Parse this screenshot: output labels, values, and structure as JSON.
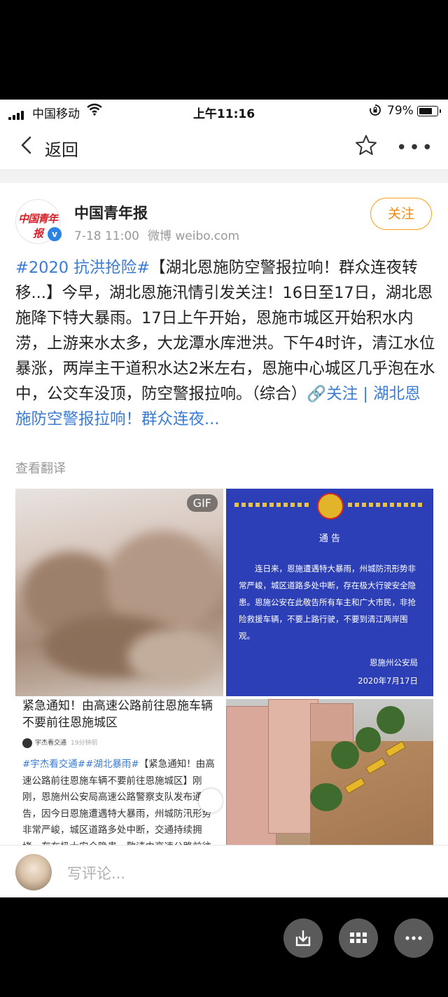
{
  "status_bar": {
    "carrier": "中国移动",
    "time": "上午11:16",
    "battery_pct": "79%",
    "battery_level": 0.79
  },
  "nav": {
    "back_label": "返回",
    "star_icon": "star-icon",
    "more_icon": "more-icon"
  },
  "post": {
    "author": "中国青年报",
    "avatar_text": "中国青年报",
    "date": "7-18 11:00",
    "source": "微博 weibo.com",
    "follow_label": "关注",
    "hashtag": "#2020 抗洪抢险#",
    "body": "【湖北恩施防空警报拉响！群众连夜转移...】今早，湖北恩施汛情引发关注！16日至17日，湖北恩施降下特大暴雨。17日上午开始，恩施市城区开始积水内涝，上游来水太多，大龙潭水库泄洪。下午4时许，清江水位暴涨，两岸主干道积水达2米左右，恩施中心城区几乎泡在水中，公交车没顶，防空警报拉响。（综合）",
    "link": "🔗关注 | 湖北恩施防空警报拉响！群众连夜...",
    "translate": "查看翻译"
  },
  "images": {
    "gif_badge": "GIF",
    "notice": {
      "title": "通 告",
      "body": "连日来，恩施遭遇特大暴雨，州城防汛形势非常严峻，城区道路多处中断，存在极大行驶安全隐患。恩施公安在此敬告所有车主和广大市民，非抢险救援车辆，不要上路行驶，不要到清江两岸围观。",
      "org": "恩施州公安局",
      "date": "2020年7月17日"
    },
    "repost": {
      "headline": "紧急通知！由高速公路前往恩施车辆不要前往恩施城区",
      "account": "宇杰看交通",
      "ago": "19分钟前",
      "tags": "#宇杰看交通##湖北暴雨#",
      "body": "【紧急通知！由高速公路前往恩施车辆不要前往恩施城区】刚刚，恩施州公安局高速公路警察支队发布通告，因今日恩施遭遇特大暴雨，州城防汛形势非常严峻，城区道路多处中断，交通持续拥堵，存在极大安全隐患，敬请由高速公路前往"
    }
  },
  "comment_bar": {
    "placeholder": "写评论..."
  },
  "fabs": [
    "download-icon",
    "grid-icon",
    "more-icon"
  ]
}
